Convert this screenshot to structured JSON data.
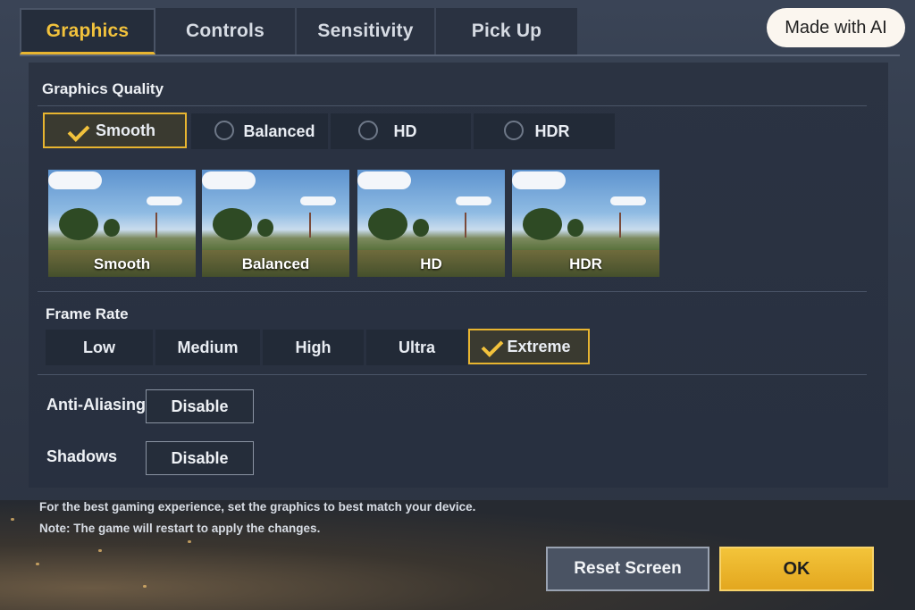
{
  "tabs": [
    {
      "label": "Graphics",
      "active": true
    },
    {
      "label": "Controls",
      "active": false
    },
    {
      "label": "Sensitivity",
      "active": false
    },
    {
      "label": "Pick Up",
      "active": false
    }
  ],
  "badge": "Made with AI",
  "graphics_quality": {
    "title": "Graphics Quality",
    "options": [
      "Smooth",
      "Balanced",
      "HD",
      "HDR"
    ],
    "selected": "Smooth",
    "previews": [
      "Smooth",
      "Balanced",
      "HD",
      "HDR"
    ]
  },
  "frame_rate": {
    "title": "Frame Rate",
    "options": [
      "Low",
      "Medium",
      "High",
      "Ultra",
      "Extreme"
    ],
    "selected": "Extreme"
  },
  "anti_aliasing": {
    "label": "Anti-Aliasing",
    "value": "Disable"
  },
  "shadows": {
    "label": "Shadows",
    "value": "Disable"
  },
  "notes": {
    "line1": "For the best gaming experience, set the graphics to best match your device.",
    "line2": "Note: The game will restart to apply the changes."
  },
  "buttons": {
    "reset": "Reset Screen",
    "ok": "OK"
  },
  "colors": {
    "accent": "#e8b530",
    "panel": "#2b3342",
    "ok_button": "#f3c43a"
  }
}
